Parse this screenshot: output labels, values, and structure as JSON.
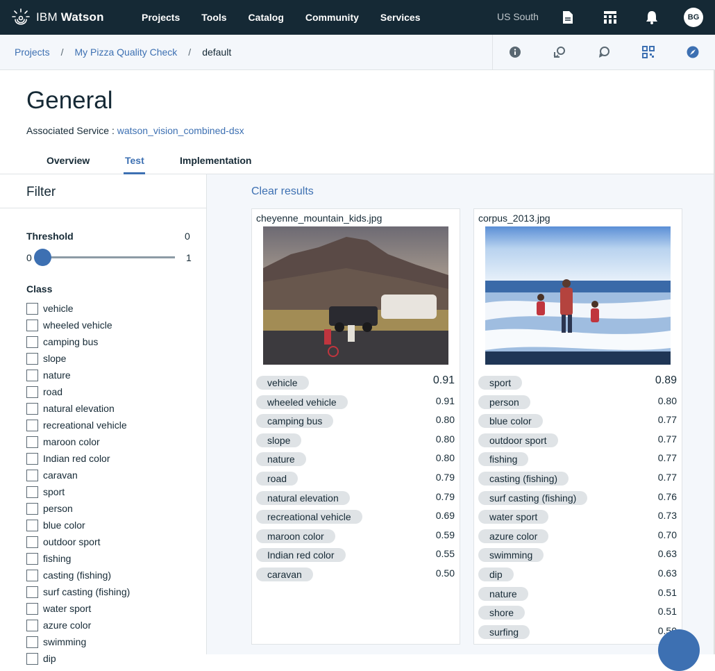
{
  "topbar": {
    "brand_prefix": "IBM",
    "brand_name": "Watson",
    "nav": [
      "Projects",
      "Tools",
      "Catalog",
      "Community",
      "Services"
    ],
    "region": "US South",
    "avatar": "BG",
    "icons": [
      "document-icon",
      "apps-grid-icon",
      "bell-icon"
    ]
  },
  "breadcrumb": {
    "items": [
      "Projects",
      "My Pizza Quality Check"
    ],
    "current": "default",
    "separator": "/",
    "actions": [
      "info-icon",
      "transfer-icon",
      "chat-icon",
      "qr-code-icon",
      "compass-icon"
    ]
  },
  "header": {
    "title": "General",
    "assoc_label": "Associated Service :",
    "assoc_service": "watson_vision_combined-dsx",
    "tabs": [
      "Overview",
      "Test",
      "Implementation"
    ],
    "active_tab": "Test"
  },
  "filter": {
    "title": "Filter",
    "threshold_label": "Threshold",
    "threshold_value": "0",
    "threshold_min": "0",
    "threshold_max": "1",
    "threshold_level": 0.0,
    "class_label": "Class",
    "classes": [
      "vehicle",
      "wheeled vehicle",
      "camping bus",
      "slope",
      "nature",
      "road",
      "natural elevation",
      "recreational vehicle",
      "maroon color",
      "Indian red color",
      "caravan",
      "sport",
      "person",
      "blue color",
      "outdoor sport",
      "fishing",
      "casting (fishing)",
      "surf casting (fishing)",
      "water sport",
      "azure color",
      "swimming",
      "dip"
    ]
  },
  "results": {
    "clear_label": "Clear results",
    "cards": [
      {
        "filename": "cheyenne_mountain_kids.jpg",
        "tags": [
          {
            "label": "vehicle",
            "score": "0.91"
          },
          {
            "label": "wheeled vehicle",
            "score": "0.91"
          },
          {
            "label": "camping bus",
            "score": "0.80"
          },
          {
            "label": "slope",
            "score": "0.80"
          },
          {
            "label": "nature",
            "score": "0.80"
          },
          {
            "label": "road",
            "score": "0.79"
          },
          {
            "label": "natural elevation",
            "score": "0.79"
          },
          {
            "label": "recreational vehicle",
            "score": "0.69"
          },
          {
            "label": "maroon color",
            "score": "0.59"
          },
          {
            "label": "Indian red color",
            "score": "0.55"
          },
          {
            "label": "caravan",
            "score": "0.50"
          }
        ]
      },
      {
        "filename": "corpus_2013.jpg",
        "tags": [
          {
            "label": "sport",
            "score": "0.89"
          },
          {
            "label": "person",
            "score": "0.80"
          },
          {
            "label": "blue color",
            "score": "0.77"
          },
          {
            "label": "outdoor sport",
            "score": "0.77"
          },
          {
            "label": "fishing",
            "score": "0.77"
          },
          {
            "label": "casting (fishing)",
            "score": "0.77"
          },
          {
            "label": "surf casting (fishing)",
            "score": "0.76"
          },
          {
            "label": "water sport",
            "score": "0.73"
          },
          {
            "label": "azure color",
            "score": "0.70"
          },
          {
            "label": "swimming",
            "score": "0.63"
          },
          {
            "label": "dip",
            "score": "0.63"
          },
          {
            "label": "nature",
            "score": "0.51"
          },
          {
            "label": "shore",
            "score": "0.51"
          },
          {
            "label": "surfing",
            "score": "0.50"
          }
        ]
      }
    ]
  },
  "colors": {
    "topbar": "#152935",
    "accent": "#3d70b2",
    "pill": "#dfe3e6",
    "results_bg": "#f4f7fb"
  }
}
